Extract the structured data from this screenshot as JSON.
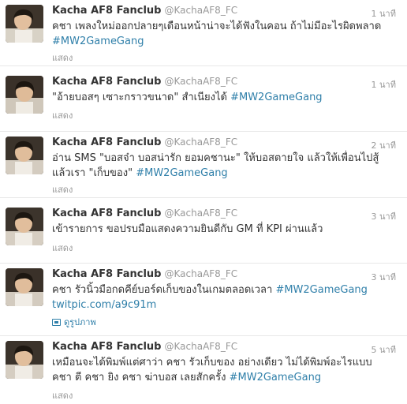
{
  "colors": {
    "link": "#2f7fa9",
    "muted": "#999999",
    "text": "#333333",
    "divider": "#e8e8e8"
  },
  "tweets": [
    {
      "fullname": "Kacha AF8 Fanclub",
      "screenname": "@KachaAF8_FC",
      "time": "1 นาที",
      "text_plain": "คชา เพลงใหม่ออกปลายๆเดือนหน้าน่าจะได้ฟังในคอน ถ้าไม่มีอะไรผิดพลาด",
      "hashtag": "#MW2GameGang",
      "action": "แสดง"
    },
    {
      "fullname": "Kacha AF8 Fanclub",
      "screenname": "@KachaAF8_FC",
      "time": "1 นาที",
      "text_plain": "\"อ้ายบอสๆ เซาะกราวขนาด\" สำเนียงได้",
      "hashtag": "#MW2GameGang",
      "action": "แสดง"
    },
    {
      "fullname": "Kacha AF8 Fanclub",
      "screenname": "@KachaAF8_FC",
      "time": "2 นาที",
      "text_plain": "อ่าน SMS \"บอสจ๋า บอสน่ารัก ยอมคชานะ\" ให้บอสตายใจ แล้วให้เพื่อนไปสู้ แล้วเรา \"เก็บของ\"",
      "hashtag": "#MW2GameGang",
      "action": "แสดง"
    },
    {
      "fullname": "Kacha AF8 Fanclub",
      "screenname": "@KachaAF8_FC",
      "time": "3 นาที",
      "text_plain": "เข้ารายการ ขอปรบมือแสดงความยินดีกับ GM ที่ KPI ผ่านแล้ว",
      "hashtag": "",
      "action": "แสดง"
    },
    {
      "fullname": "Kacha AF8 Fanclub",
      "screenname": "@KachaAF8_FC",
      "time": "3 นาที",
      "text_plain": "คชา รัวนิ้วมือกดคีย์บอร์ดเก็บของในเกมตลอดเวลา",
      "hashtag": "#MW2GameGang",
      "link": "twitpic.com/a9c91m",
      "photo_label": "ดูรูปภาพ",
      "action": ""
    },
    {
      "fullname": "Kacha AF8 Fanclub",
      "screenname": "@KachaAF8_FC",
      "time": "5 นาที",
      "text_plain": "เหมือนจะได้พิมพ์แต่ศาว่า คชา รัวเก็บของ อย่างเดียว ไม่ได้พิมพ์อะไรแบบ คชา ตี คชา ยิง คชา ฆ่าบอส เลยสักครั้ง",
      "hashtag": "#MW2GameGang",
      "action": "แสดง"
    }
  ]
}
